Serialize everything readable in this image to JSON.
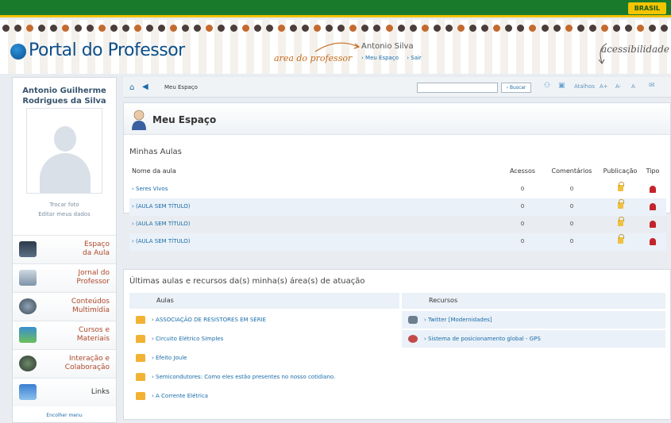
{
  "gov_bar": {
    "badge": "BRASIL"
  },
  "header": {
    "logo_text": "Portal do Professor",
    "area_label": "area do professor",
    "user_name": "Antonio Silva",
    "user_links": [
      "Meu Espaço",
      "Sair"
    ],
    "accessibility": "acessibilidade"
  },
  "sidebar": {
    "name": "Antonio Guilherme Rodrigues da Silva",
    "trocar_foto": "Trocar foto",
    "editar_dados": "Editar meus dados",
    "menu": [
      {
        "label": "Espaço\nda Aula",
        "icon": "classroom-icon"
      },
      {
        "label": "Jornal do\nProfessor",
        "icon": "newspaper-icon"
      },
      {
        "label": "Conteúdos\nMultimídia",
        "icon": "multimedia-icon"
      },
      {
        "label": "Cursos e\nMateriais",
        "icon": "books-icon"
      },
      {
        "label": "Interação e\nColaboração",
        "icon": "people-icon"
      },
      {
        "label": "Links",
        "icon": "links-icon"
      }
    ],
    "encolher": "Encolher menu"
  },
  "toolbar": {
    "breadcrumb": "Meu Espaço",
    "search_button": "Buscar",
    "atalhos": "Atalhos",
    "font_plus": "A+",
    "font_minus": "A-",
    "font_reset": "A"
  },
  "page": {
    "title": "Meu Espaço"
  },
  "minhas_aulas": {
    "title": "Minhas Aulas",
    "columns": [
      "Nome da aula",
      "Acessos",
      "Comentários",
      "Publicação",
      "Tipo"
    ],
    "rows": [
      {
        "nome": "Seres Vivos",
        "acessos": "0",
        "comentarios": "0"
      },
      {
        "nome": "(AULA SEM TÍTULO)",
        "acessos": "0",
        "comentarios": "0"
      },
      {
        "nome": "(AULA SEM TÍTULO)",
        "acessos": "0",
        "comentarios": "0"
      },
      {
        "nome": "(AULA SEM TÍTULO)",
        "acessos": "0",
        "comentarios": "0"
      }
    ]
  },
  "ultimas": {
    "title": "Últimas aulas e recursos da(s) minha(s) área(s) de atuação",
    "aulas_header": "Aulas",
    "recursos_header": "Recursos",
    "aulas": [
      "ASSOCIAÇÃO DE RESISTORES EM SÉRIE",
      "Circuito Elétrico Simples",
      "Efeito Joule",
      "Semicondutores: Como eles estão presentes no nosso cotidiano.",
      "A Corrente Elétrica"
    ],
    "recursos": [
      "Twitter [Modernidades]",
      "Sistema de posicionamento global - GPS"
    ]
  }
}
